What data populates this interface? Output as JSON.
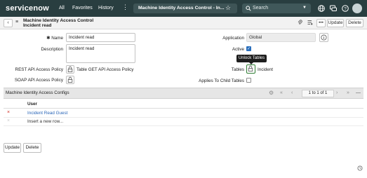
{
  "topnav": {
    "logo": "servicenow",
    "links": [
      "All",
      "Favorites",
      "History"
    ],
    "tab_title": "Machine Identity Access Control - In...",
    "search_placeholder": "Search"
  },
  "header": {
    "back_icon": "chevron-left-icon",
    "title": "Machine Identity Access Control",
    "subtitle": "Incident read",
    "update_label": "Update",
    "delete_label": "Delete"
  },
  "form": {
    "name_label": "Name",
    "name_value": "Incident read",
    "description_label": "Description",
    "description_value": "Incident read",
    "application_label": "Application",
    "application_value": "Global",
    "active_label": "Active",
    "rest_label": "REST API Access Policy",
    "rest_value": "Table GET API Access Policy",
    "soap_label": "SOAP API Access Policy",
    "tables_label": "Tables",
    "tables_value": "Incident",
    "child_tables_label": "Applies To Child Tables",
    "tooltip": "Unlock Tables"
  },
  "related_list": {
    "title": "Machine Identity Access Configs",
    "pagination": "1   to 1 of 1",
    "column_user": "User",
    "rows": [
      {
        "user": "Incident Read Guest"
      }
    ],
    "insert_row": "Insert a new row..."
  },
  "footer": {
    "update_label": "Update",
    "delete_label": "Delete"
  },
  "colors": {
    "nav_bg": "#293e40",
    "link": "#2a66b8",
    "accent_check": "#2a6fbd",
    "delete_x": "#d0281e"
  }
}
